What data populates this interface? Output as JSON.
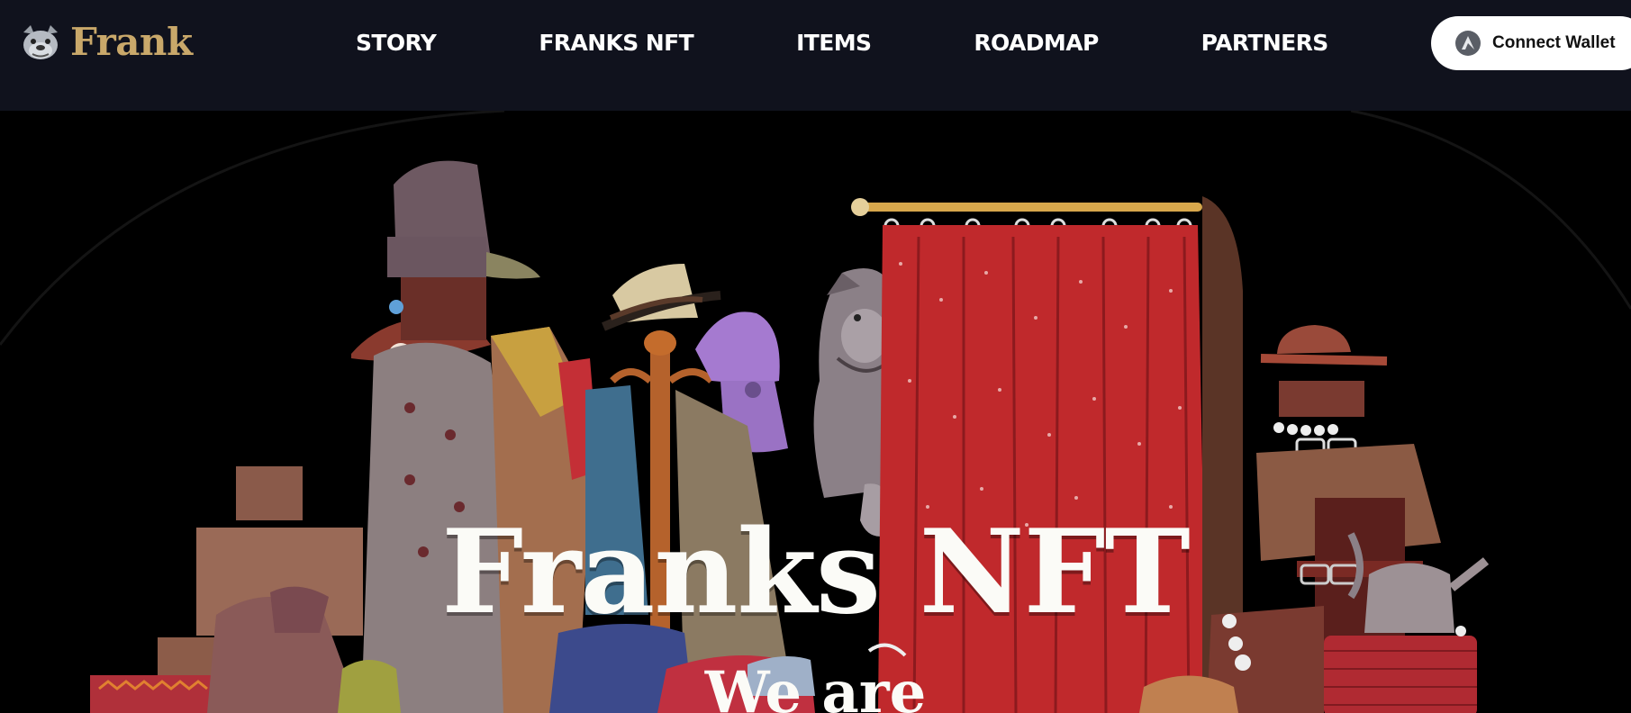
{
  "brand": {
    "name": "Frank",
    "logo_icon": "bulldog-head-icon",
    "color": "#c9a86a"
  },
  "nav": {
    "items": [
      {
        "label": "STORY"
      },
      {
        "label": "FRANKS NFT"
      },
      {
        "label": "ITEMS"
      },
      {
        "label": "ROADMAP"
      },
      {
        "label": "PARTNERS"
      }
    ],
    "background": "#10121d"
  },
  "wallet_button": {
    "label": "Connect Wallet",
    "icon": "wallet-logo-icon"
  },
  "hero": {
    "title": "Franks NFT",
    "subtitle": "We are",
    "illustration": "bulldog-peeking-behind-red-curtain-with-clothes-rack"
  },
  "colors": {
    "curtain": "#c0292c",
    "hero_background": "#000000",
    "text": "#ffffff"
  }
}
